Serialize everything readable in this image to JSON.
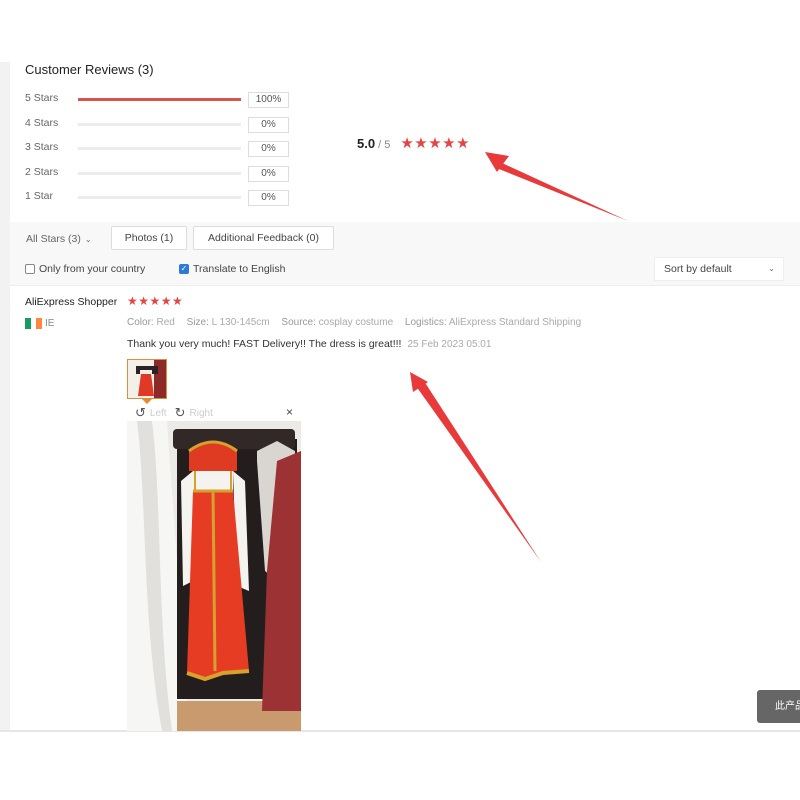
{
  "reviews_section": {
    "title": "Customer Reviews (3)",
    "distribution": [
      {
        "label": "5 Stars",
        "percent_text": "100%",
        "fill_fraction": 1.0
      },
      {
        "label": "4 Stars",
        "percent_text": "0%",
        "fill_fraction": 0
      },
      {
        "label": "3 Stars",
        "percent_text": "0%",
        "fill_fraction": 0
      },
      {
        "label": "2 Stars",
        "percent_text": "0%",
        "fill_fraction": 0
      },
      {
        "label": "1 Star",
        "percent_text": "0%",
        "fill_fraction": 0
      }
    ],
    "summary": {
      "score": "5.0",
      "out_of": "/ 5",
      "stars": "★★★★★",
      "rating_value": 5
    }
  },
  "filters": {
    "all_stars": "All Stars (3)",
    "all_stars_chevron": "⌄",
    "photos": "Photos (1)",
    "additional_feedback": "Additional Feedback (0)",
    "only_country": {
      "label": "Only from your country",
      "checked": false
    },
    "translate": {
      "label": "Translate to English",
      "checked": true,
      "check_glyph": "✓"
    },
    "sort": {
      "selected": "Sort by default",
      "chevron": "⌄"
    }
  },
  "review": {
    "reviewer": "AliExpress Shopper",
    "stars": "★★★★★",
    "rating_value": 5,
    "country_code": "IE",
    "flag_colors": [
      "#169b62",
      "#ffffff",
      "#ff883e"
    ],
    "attributes": [
      {
        "key": "Color:",
        "value": "Red"
      },
      {
        "key": "Size:",
        "value": "L 130-145cm"
      },
      {
        "key": "Source:",
        "value": "cosplay costume"
      },
      {
        "key": "Logistics:",
        "value": "AliExpress Standard Shipping"
      }
    ],
    "text": "Thank you very much! FAST Delivery!! The dress is great!!!",
    "date": "25 Feb 2023 05:01",
    "viewer": {
      "rotate_left_icon": "↺",
      "rotate_left": "Left",
      "rotate_right_icon": "↻",
      "rotate_right": "Right",
      "close": "×"
    }
  },
  "floating_button": {
    "label": "此产品"
  },
  "colors": {
    "accent_red": "#e64545",
    "bar_fill": "#d9534f",
    "checkbox_blue": "#2d7bd6",
    "annotation_arrow": "#e83a3a"
  }
}
